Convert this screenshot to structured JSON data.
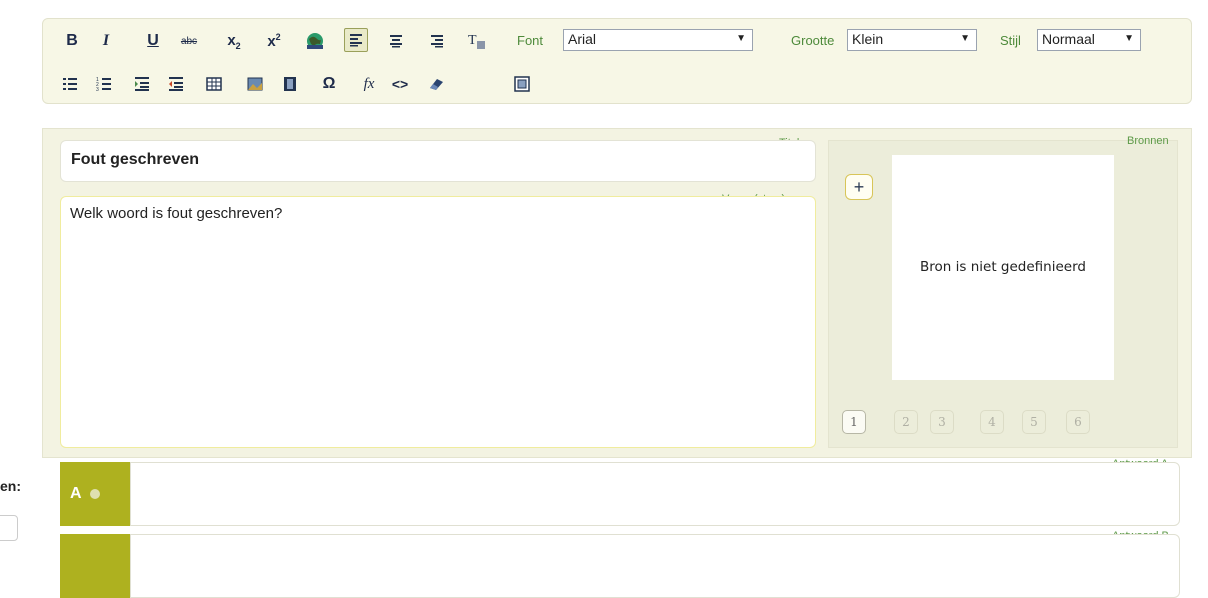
{
  "toolbar": {
    "font_label": "Font",
    "font_value": "Arial",
    "size_label": "Grootte",
    "size_value": "Klein",
    "style_label": "Stijl",
    "style_value": "Normaal",
    "underline_glyph": "U",
    "bold_glyph": "B",
    "italic_glyph": "I",
    "strike_glyph": "abc",
    "omega_glyph": "Ω",
    "fx_glyph": "fx",
    "code_glyph": "<>",
    "dropdown_glyph": "▼"
  },
  "editor": {
    "title_label": "Titel",
    "title_value": "Fout geschreven",
    "stem_label": "Vraag (stam)",
    "stem_value": "Welk woord is fout geschreven?"
  },
  "sources": {
    "label": "Bronnen",
    "add_glyph": "+",
    "empty_text": "Bron is niet gedefinieerd",
    "pages": [
      "1",
      "2",
      "3",
      "4",
      "5",
      "6"
    ],
    "current_page": "1"
  },
  "answers": [
    {
      "letter": "A",
      "label": "Antwoord A",
      "value": ""
    },
    {
      "letter": "",
      "label": "Antwoord B",
      "value": ""
    }
  ],
  "side": {
    "cutoff_label": "en:"
  },
  "colors": {
    "accent_green": "#aeb11f",
    "label_green": "#5d9a48"
  }
}
